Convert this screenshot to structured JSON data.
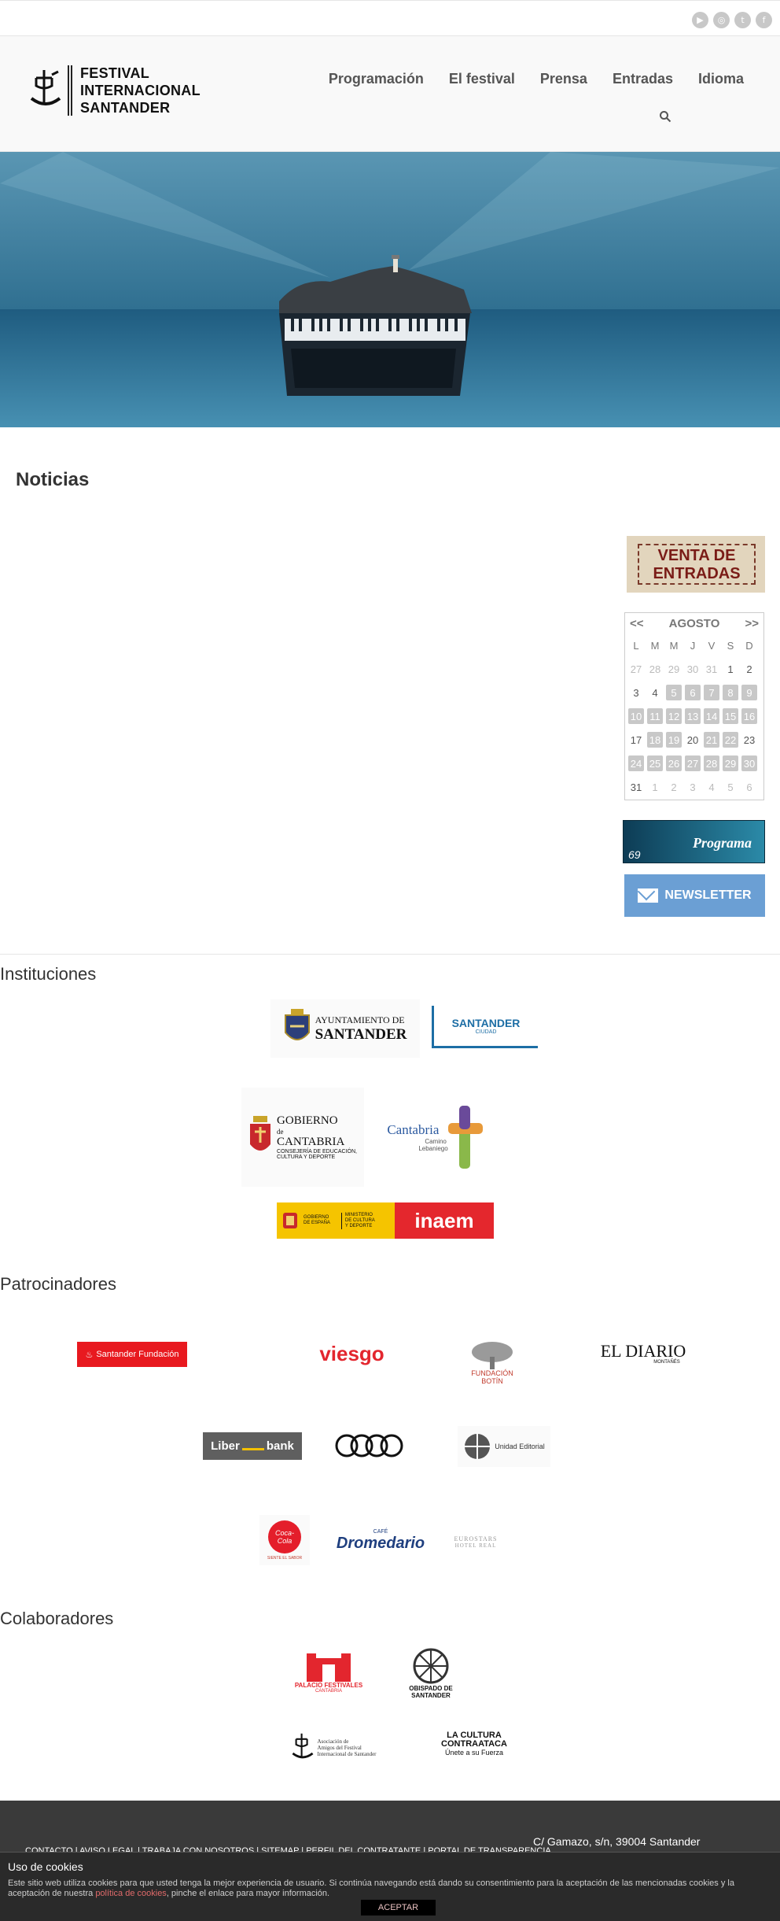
{
  "social": {
    "youtube": "▶",
    "instagram": "◎",
    "twitter": "t",
    "facebook": "f"
  },
  "logo": {
    "line1": "FESTIVAL",
    "line2": "INTERNACIONAL",
    "line3": "SANTANDER"
  },
  "nav": [
    "Programación",
    "El festival",
    "Prensa",
    "Entradas",
    "Idioma"
  ],
  "main": {
    "title": "Noticias"
  },
  "sidebar": {
    "venta_line1": "VENTA DE",
    "venta_line2": "ENTRADAS",
    "calendar": {
      "prev": "<<",
      "month": "AGOSTO",
      "next": ">>",
      "weekdays": [
        "L",
        "M",
        "M",
        "J",
        "V",
        "S",
        "D"
      ],
      "days": [
        {
          "d": "27",
          "s": "o"
        },
        {
          "d": "28",
          "s": "o"
        },
        {
          "d": "29",
          "s": "o"
        },
        {
          "d": "30",
          "s": "o"
        },
        {
          "d": "31",
          "s": "o"
        },
        {
          "d": "1",
          "s": ""
        },
        {
          "d": "2",
          "s": ""
        },
        {
          "d": "3",
          "s": ""
        },
        {
          "d": "4",
          "s": ""
        },
        {
          "d": "5",
          "s": "g"
        },
        {
          "d": "6",
          "s": "g"
        },
        {
          "d": "7",
          "s": "g"
        },
        {
          "d": "8",
          "s": "g"
        },
        {
          "d": "9",
          "s": "g"
        },
        {
          "d": "10",
          "s": "g"
        },
        {
          "d": "11",
          "s": "g"
        },
        {
          "d": "12",
          "s": "g"
        },
        {
          "d": "13",
          "s": "g"
        },
        {
          "d": "14",
          "s": "g"
        },
        {
          "d": "15",
          "s": "g"
        },
        {
          "d": "16",
          "s": "g"
        },
        {
          "d": "17",
          "s": ""
        },
        {
          "d": "18",
          "s": "g"
        },
        {
          "d": "19",
          "s": "g"
        },
        {
          "d": "20",
          "s": ""
        },
        {
          "d": "21",
          "s": "g"
        },
        {
          "d": "22",
          "s": "g"
        },
        {
          "d": "23",
          "s": ""
        },
        {
          "d": "24",
          "s": "g"
        },
        {
          "d": "25",
          "s": "g"
        },
        {
          "d": "26",
          "s": "g"
        },
        {
          "d": "27",
          "s": "g"
        },
        {
          "d": "28",
          "s": "g"
        },
        {
          "d": "29",
          "s": "g"
        },
        {
          "d": "30",
          "s": "g"
        },
        {
          "d": "31",
          "s": ""
        },
        {
          "d": "1",
          "s": "o"
        },
        {
          "d": "2",
          "s": "o"
        },
        {
          "d": "3",
          "s": "o"
        },
        {
          "d": "4",
          "s": "o"
        },
        {
          "d": "5",
          "s": "o"
        },
        {
          "d": "6",
          "s": "o"
        }
      ]
    },
    "programa_num": "69",
    "programa_label": "Programa",
    "newsletter_label": "NEWSLETTER"
  },
  "sections": {
    "instituciones": "Instituciones",
    "patrocinadores": "Patrocinadores",
    "colaboradores": "Colaboradores"
  },
  "logos": {
    "ayto_1": "AYUNTAMIENTO DE",
    "ayto_2": "SANTANDER",
    "santander_ciudad_1": "SANTANDER",
    "santander_ciudad_2": "CIUDAD",
    "gobierno_1": "GOBIERNO",
    "gobierno_2": "de",
    "gobierno_3": "CANTABRIA",
    "gobierno_4": "CONSEJERÍA DE EDUCACIÓN,",
    "gobierno_5": "CULTURA Y DEPORTE",
    "cantabria_1": "Cantabria",
    "cantabria_2": "Camino",
    "cantabria_3": "Lebaniego",
    "gob_espana_1": "GOBIERNO",
    "gob_espana_2": "DE ESPAÑA",
    "ministerio_1": "MINISTERIO",
    "ministerio_2": "DE CULTURA",
    "ministerio_3": "Y DEPORTE",
    "inaem": "inaem",
    "santander_fundacion": "Santander Fundación",
    "viesgo": "viesgo",
    "fundacion_1": "FUNDACIÓN",
    "fundacion_2": "BOTÍN",
    "eldiario_1": "EL DIARIO",
    "eldiario_2": "MONTAÑÉS",
    "liberbank_1": "Liber",
    "liberbank_2": "bank",
    "unidad": "Unidad Editorial",
    "cocacola_1": "Coca-Cola",
    "cocacola_2": "SIENTE EL SABOR",
    "dromedario_1": "CAFÉ",
    "dromedario_2": "Dromedario",
    "eurostars_1": "EUROSTARS",
    "eurostars_2": "HOTEL REAL",
    "palacio_1": "PALACIO FESTIVALES",
    "palacio_2": "CANTABRIA",
    "obispado_1": "OBISPADO DE",
    "obispado_2": "SANTANDER",
    "amigos_1": "Asociación de",
    "amigos_2": "Amigos del Festival",
    "amigos_3": "Internacional de Santander",
    "cultura_1": "LA CULTURA",
    "cultura_2": "CONTRAATACA",
    "cultura_3": "Únete a su Fuerza"
  },
  "footer": {
    "links": "CONTACTO | AVISO LEGAL | TRABAJA CON NOSOTROS | SITEMAP | PERFIL DEL CONTRATANTE | PORTAL DE TRANSPARENCIA",
    "address": "C/ Gamazo, s/n, 39004 Santander"
  },
  "cookies": {
    "title": "Uso de cookies",
    "text_a": "Este sitio web utiliza cookies para que usted tenga la mejor experiencia de usuario. Si continúa navegando está dando su consentimiento para la aceptación de las mencionadas cookies y la aceptación de nuestra ",
    "link": "política de cookies",
    "text_b": ", pinche el enlace para mayor información.",
    "accept": "ACEPTAR"
  }
}
